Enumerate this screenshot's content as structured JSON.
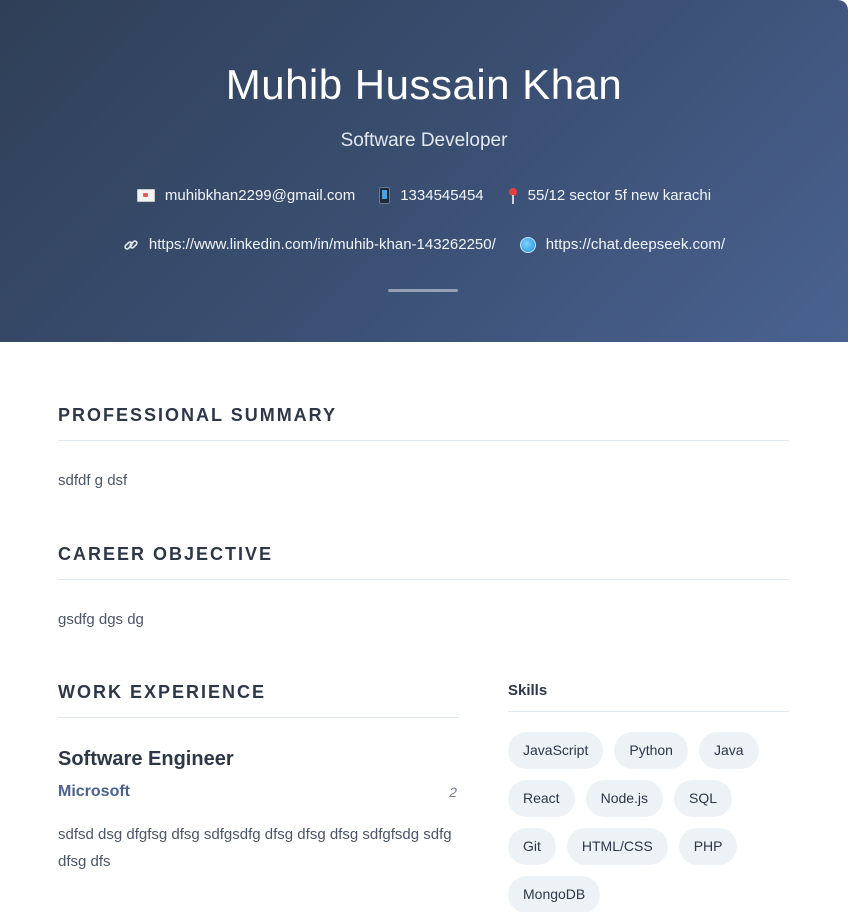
{
  "header": {
    "name": "Muhib Hussain Khan",
    "role": "Software Developer",
    "email": "muhibkhan2299@gmail.com",
    "phone": "1334545454",
    "address": "55/12 sector 5f new karachi",
    "linkedin": "https://www.linkedin.com/in/muhib-khan-143262250/",
    "website": "https://chat.deepseek.com/",
    "icons": [
      "mail-icon",
      "phone-icon",
      "location-pin-icon",
      "link-icon",
      "globe-icon"
    ]
  },
  "summary": {
    "title": "PROFESSIONAL SUMMARY",
    "text": "sdfdf g dsf"
  },
  "objective": {
    "title": "CAREER OBJECTIVE",
    "text": "gsdfg dgs dg"
  },
  "work": {
    "title": "WORK EXPERIENCE",
    "jobs": [
      {
        "title": "Software Engineer",
        "company": "Microsoft",
        "duration": "2",
        "description": "sdfsd dsg dfgfsg dfsg sdfgsdfg dfsg dfsg dfsg sdfgfsdg sdfg dfsg dfs"
      }
    ]
  },
  "skills": {
    "title": "Skills",
    "items": [
      "JavaScript",
      "Python",
      "Java",
      "React",
      "Node.js",
      "SQL",
      "Git",
      "HTML/CSS",
      "PHP",
      "MongoDB"
    ]
  },
  "colors": {
    "header_gradient_start": "#2f3f57",
    "header_gradient_end": "#4a6291",
    "accent": "#4a6291",
    "tag_background": "#edf2f7"
  }
}
